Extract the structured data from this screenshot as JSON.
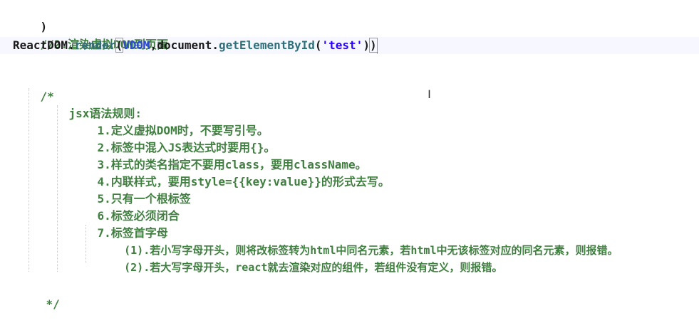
{
  "code": {
    "line1_close": ")",
    "line2_comment": "//2.渲染虚拟DOM到页面",
    "line3": {
      "obj": "ReactDOM",
      "dot1": ".",
      "method": "render",
      "open_paren": "(",
      "arg1": "VDOM",
      "comma": ",",
      "doc": "document",
      "dot2": ".",
      "getter": "getElementById",
      "open_paren2": "(",
      "arg_str": "'test'",
      "close_paren2": ")",
      "close_paren": ")"
    },
    "comment_open": "/*",
    "rules_title": "jsx语法规则:",
    "rules": [
      "1.定义虚拟DOM时，不要写引号。",
      "2.标签中混入JS表达式时要用{}。",
      "3.样式的类名指定不要用class，要用className。",
      "4.内联样式，要用style={{key:value}}的形式去写。",
      "5.只有一个根标签",
      "6.标签必须闭合",
      "7.标签首字母"
    ],
    "sub_rules": [
      "(1).若小写字母开头，则将改标签转为html中同名元素，若html中无该标签对应的同名元素，则报错。",
      "(2).若大写字母开头，react就去渲染对应的组件，若组件没有定义，则报错。"
    ],
    "comment_close": "*/"
  },
  "cursor": {
    "icon": "text-ibeam-icon",
    "glyph": "I"
  },
  "colors": {
    "comment": "#3f7f3f",
    "identifier": "#1a1a1a",
    "method": "#2e6f7a",
    "argument": "#2a4bd0",
    "string": "#2a00ff"
  }
}
